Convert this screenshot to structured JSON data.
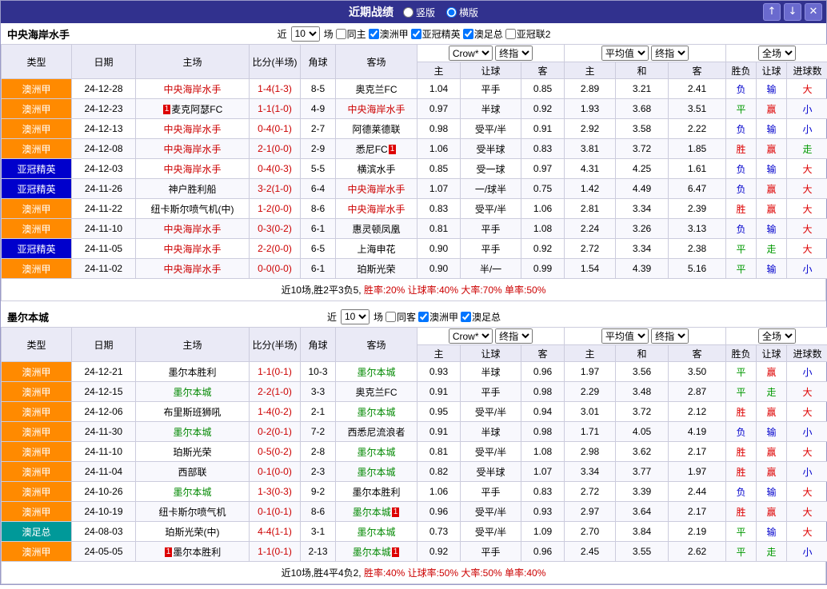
{
  "topbar": {
    "title": "近期战绩",
    "layout_options": [
      {
        "label": "竖版",
        "selected": false
      },
      {
        "label": "横版",
        "selected": true
      }
    ],
    "up_button": "↑",
    "down_button": "↓",
    "close_button": "✕"
  },
  "columns": {
    "type": "类型",
    "date": "日期",
    "home": "主场",
    "score": "比分(半场)",
    "corner": "角球",
    "away": "客场",
    "odds_home": "主",
    "odds_handicap": "让球",
    "odds_away": "客",
    "avg_home": "主",
    "avg_draw": "和",
    "avg_away": "客",
    "res_wdl": "胜负",
    "res_handicap": "让球",
    "res_goals": "进球数"
  },
  "selects": {
    "bookmaker": "Crow*",
    "final_odds": "终指",
    "average": "平均值",
    "final_odds2": "终指",
    "full_match": "全场"
  },
  "colors": {
    "league": {
      "澳洲甲": "#ff8a00",
      "亚冠精英": "#0000cc",
      "澳足总": "#009999"
    },
    "result": {
      "胜": "#dd0000",
      "平": "#009900",
      "负": "#0000cc",
      "赢": "#dd0000",
      "走": "#009900",
      "输": "#0000cc",
      "大": "#dd0000",
      "小": "#0000cc"
    },
    "focus": {
      "red": "#cc0000",
      "green": "#008800"
    }
  },
  "sections": [
    {
      "team": "中央海岸水手",
      "filter": {
        "near": "近",
        "count": "10",
        "unit": "场",
        "checkboxes": [
          {
            "label": "同主",
            "checked": false
          },
          {
            "label": "澳洲甲",
            "checked": true
          },
          {
            "label": "亚冠精英",
            "checked": true
          },
          {
            "label": "澳足总",
            "checked": true
          },
          {
            "label": "亚冠联2",
            "checked": false
          }
        ]
      },
      "rows": [
        {
          "league": "澳洲甲",
          "date": "24-12-28",
          "home": {
            "text": "中央海岸水手",
            "color": "red"
          },
          "score": "1-4(1-3)",
          "corner": "8-5",
          "away": {
            "text": "奥克兰FC"
          },
          "odds": [
            "1.04",
            "平手",
            "0.85"
          ],
          "avg": [
            "2.89",
            "3.21",
            "2.41"
          ],
          "res": [
            "负",
            "输",
            "大"
          ]
        },
        {
          "league": "澳洲甲",
          "date": "24-12-23",
          "home": {
            "text": "麦克阿瑟FC",
            "badge_before": "1"
          },
          "score": "1-1(1-0)",
          "corner": "4-9",
          "away": {
            "text": "中央海岸水手",
            "color": "red"
          },
          "odds": [
            "0.97",
            "半球",
            "0.92"
          ],
          "avg": [
            "1.93",
            "3.68",
            "3.51"
          ],
          "res": [
            "平",
            "赢",
            "小"
          ]
        },
        {
          "league": "澳洲甲",
          "date": "24-12-13",
          "home": {
            "text": "中央海岸水手",
            "color": "red"
          },
          "score": "0-4(0-1)",
          "corner": "2-7",
          "away": {
            "text": "阿德莱德联"
          },
          "odds": [
            "0.98",
            "受平/半",
            "0.91"
          ],
          "avg": [
            "2.92",
            "3.58",
            "2.22"
          ],
          "res": [
            "负",
            "输",
            "小"
          ]
        },
        {
          "league": "澳洲甲",
          "date": "24-12-08",
          "home": {
            "text": "中央海岸水手",
            "color": "red"
          },
          "score": "2-1(0-0)",
          "corner": "2-9",
          "away": {
            "text": "悉尼FC",
            "badge_after": "1"
          },
          "odds": [
            "1.06",
            "受半球",
            "0.83"
          ],
          "avg": [
            "3.81",
            "3.72",
            "1.85"
          ],
          "res": [
            "胜",
            "赢",
            "走"
          ]
        },
        {
          "league": "亚冠精英",
          "date": "24-12-03",
          "home": {
            "text": "中央海岸水手",
            "color": "red"
          },
          "score": "0-4(0-3)",
          "corner": "5-5",
          "away": {
            "text": "横滨水手"
          },
          "odds": [
            "0.85",
            "受一球",
            "0.97"
          ],
          "avg": [
            "4.31",
            "4.25",
            "1.61"
          ],
          "res": [
            "负",
            "输",
            "大"
          ]
        },
        {
          "league": "亚冠精英",
          "date": "24-11-26",
          "home": {
            "text": "神户胜利船"
          },
          "score": "3-2(1-0)",
          "corner": "6-4",
          "away": {
            "text": "中央海岸水手",
            "color": "red"
          },
          "odds": [
            "1.07",
            "一/球半",
            "0.75"
          ],
          "avg": [
            "1.42",
            "4.49",
            "6.47"
          ],
          "res": [
            "负",
            "赢",
            "大"
          ]
        },
        {
          "league": "澳洲甲",
          "date": "24-11-22",
          "home": {
            "text": "纽卡斯尔喷气机(中)"
          },
          "score": "1-2(0-0)",
          "corner": "8-6",
          "away": {
            "text": "中央海岸水手",
            "color": "red"
          },
          "odds": [
            "0.83",
            "受平/半",
            "1.06"
          ],
          "avg": [
            "2.81",
            "3.34",
            "2.39"
          ],
          "res": [
            "胜",
            "赢",
            "大"
          ]
        },
        {
          "league": "澳洲甲",
          "date": "24-11-10",
          "home": {
            "text": "中央海岸水手",
            "color": "red"
          },
          "score": "0-3(0-2)",
          "corner": "6-1",
          "away": {
            "text": "惠灵顿凤凰"
          },
          "odds": [
            "0.81",
            "平手",
            "1.08"
          ],
          "avg": [
            "2.24",
            "3.26",
            "3.13"
          ],
          "res": [
            "负",
            "输",
            "大"
          ]
        },
        {
          "league": "亚冠精英",
          "date": "24-11-05",
          "home": {
            "text": "中央海岸水手",
            "color": "red"
          },
          "score": "2-2(0-0)",
          "corner": "6-5",
          "away": {
            "text": "上海申花"
          },
          "odds": [
            "0.90",
            "平手",
            "0.92"
          ],
          "avg": [
            "2.72",
            "3.34",
            "2.38"
          ],
          "res": [
            "平",
            "走",
            "大"
          ]
        },
        {
          "league": "澳洲甲",
          "date": "24-11-02",
          "home": {
            "text": "中央海岸水手",
            "color": "red"
          },
          "score": "0-0(0-0)",
          "corner": "6-1",
          "away": {
            "text": "珀斯光荣"
          },
          "odds": [
            "0.90",
            "半/一",
            "0.99"
          ],
          "avg": [
            "1.54",
            "4.39",
            "5.16"
          ],
          "res": [
            "平",
            "输",
            "小"
          ]
        }
      ],
      "summary": {
        "record": "近10场,胜2平3负5, ",
        "rates": "胜率:20% 让球率:40% 大率:70% 单率:50%"
      }
    },
    {
      "team": "墨尔本城",
      "filter": {
        "near": "近",
        "count": "10",
        "unit": "场",
        "checkboxes": [
          {
            "label": "同客",
            "checked": false
          },
          {
            "label": "澳洲甲",
            "checked": true
          },
          {
            "label": "澳足总",
            "checked": true
          }
        ]
      },
      "rows": [
        {
          "league": "澳洲甲",
          "date": "24-12-21",
          "home": {
            "text": "墨尔本胜利"
          },
          "score": "1-1(0-1)",
          "corner": "10-3",
          "away": {
            "text": "墨尔本城",
            "color": "green"
          },
          "odds": [
            "0.93",
            "半球",
            "0.96"
          ],
          "avg": [
            "1.97",
            "3.56",
            "3.50"
          ],
          "res": [
            "平",
            "赢",
            "小"
          ]
        },
        {
          "league": "澳洲甲",
          "date": "24-12-15",
          "home": {
            "text": "墨尔本城",
            "color": "green"
          },
          "score": "2-2(1-0)",
          "corner": "3-3",
          "away": {
            "text": "奥克兰FC"
          },
          "odds": [
            "0.91",
            "平手",
            "0.98"
          ],
          "avg": [
            "2.29",
            "3.48",
            "2.87"
          ],
          "res": [
            "平",
            "走",
            "大"
          ]
        },
        {
          "league": "澳洲甲",
          "date": "24-12-06",
          "home": {
            "text": "布里斯班狮吼"
          },
          "score": "1-4(0-2)",
          "corner": "2-1",
          "away": {
            "text": "墨尔本城",
            "color": "green"
          },
          "odds": [
            "0.95",
            "受平/半",
            "0.94"
          ],
          "avg": [
            "3.01",
            "3.72",
            "2.12"
          ],
          "res": [
            "胜",
            "赢",
            "大"
          ]
        },
        {
          "league": "澳洲甲",
          "date": "24-11-30",
          "home": {
            "text": "墨尔本城",
            "color": "green"
          },
          "score": "0-2(0-1)",
          "corner": "7-2",
          "away": {
            "text": "西悉尼流浪者"
          },
          "odds": [
            "0.91",
            "半球",
            "0.98"
          ],
          "avg": [
            "1.71",
            "4.05",
            "4.19"
          ],
          "res": [
            "负",
            "输",
            "小"
          ]
        },
        {
          "league": "澳洲甲",
          "date": "24-11-10",
          "home": {
            "text": "珀斯光荣"
          },
          "score": "0-5(0-2)",
          "corner": "2-8",
          "away": {
            "text": "墨尔本城",
            "color": "green"
          },
          "odds": [
            "0.81",
            "受平/半",
            "1.08"
          ],
          "avg": [
            "2.98",
            "3.62",
            "2.17"
          ],
          "res": [
            "胜",
            "赢",
            "大"
          ]
        },
        {
          "league": "澳洲甲",
          "date": "24-11-04",
          "home": {
            "text": "西部联"
          },
          "score": "0-1(0-0)",
          "corner": "2-3",
          "away": {
            "text": "墨尔本城",
            "color": "green"
          },
          "odds": [
            "0.82",
            "受半球",
            "1.07"
          ],
          "avg": [
            "3.34",
            "3.77",
            "1.97"
          ],
          "res": [
            "胜",
            "赢",
            "小"
          ]
        },
        {
          "league": "澳洲甲",
          "date": "24-10-26",
          "home": {
            "text": "墨尔本城",
            "color": "green"
          },
          "score": "1-3(0-3)",
          "corner": "9-2",
          "away": {
            "text": "墨尔本胜利"
          },
          "odds": [
            "1.06",
            "平手",
            "0.83"
          ],
          "avg": [
            "2.72",
            "3.39",
            "2.44"
          ],
          "res": [
            "负",
            "输",
            "大"
          ]
        },
        {
          "league": "澳洲甲",
          "date": "24-10-19",
          "home": {
            "text": "纽卡斯尔喷气机"
          },
          "score": "0-1(0-1)",
          "corner": "8-6",
          "away": {
            "text": "墨尔本城",
            "color": "green",
            "badge_after": "1"
          },
          "odds": [
            "0.96",
            "受平/半",
            "0.93"
          ],
          "avg": [
            "2.97",
            "3.64",
            "2.17"
          ],
          "res": [
            "胜",
            "赢",
            "大"
          ]
        },
        {
          "league": "澳足总",
          "date": "24-08-03",
          "home": {
            "text": "珀斯光荣(中)"
          },
          "score": "4-4(1-1)",
          "corner": "3-1",
          "away": {
            "text": "墨尔本城",
            "color": "green"
          },
          "odds": [
            "0.73",
            "受平/半",
            "1.09"
          ],
          "avg": [
            "2.70",
            "3.84",
            "2.19"
          ],
          "res": [
            "平",
            "输",
            "大"
          ]
        },
        {
          "league": "澳洲甲",
          "date": "24-05-05",
          "home": {
            "text": "墨尔本胜利",
            "badge_before": "1"
          },
          "score": "1-1(0-1)",
          "corner": "2-13",
          "away": {
            "text": "墨尔本城",
            "color": "green",
            "badge_after": "1"
          },
          "odds": [
            "0.92",
            "平手",
            "0.96"
          ],
          "avg": [
            "2.45",
            "3.55",
            "2.62"
          ],
          "res": [
            "平",
            "走",
            "小"
          ]
        }
      ],
      "summary": {
        "record": "近10场,胜4平4负2, ",
        "rates": "胜率:40% 让球率:50% 大率:50% 单率:40%"
      }
    }
  ]
}
